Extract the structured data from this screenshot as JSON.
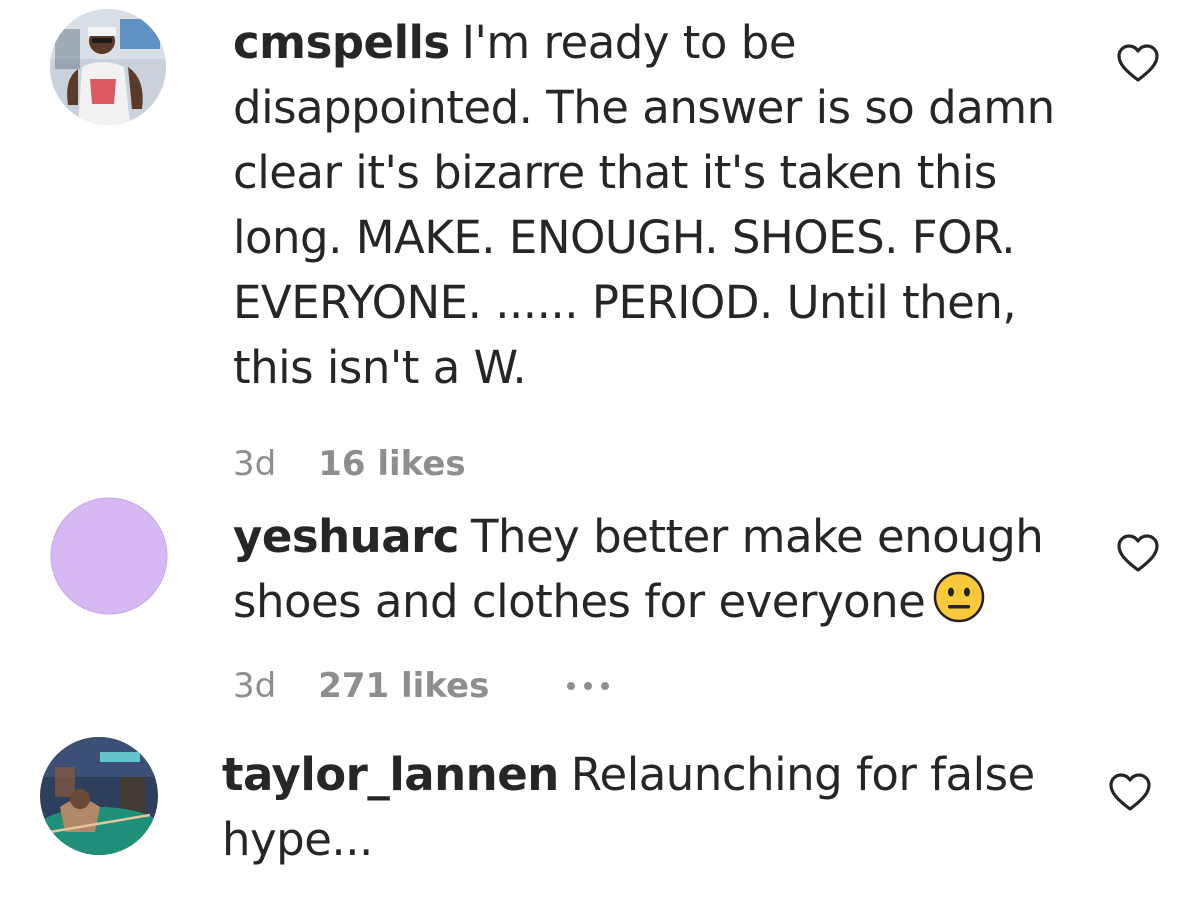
{
  "comments": [
    {
      "username": "cmspells",
      "text": "I'm ready to be disappointed. The answer is so damn clear it's bizarre that it's taken this long. MAKE. ENOUGH. SHOES. FOR. EVERYONE. ...... PERIOD. Until then, this isn't a W.",
      "time": "3d",
      "likes": "16 likes",
      "avatar_icon": "profile-photo"
    },
    {
      "username": "yeshuarc",
      "text": "They better make enough shoes and clothes for everyone",
      "emoji": "neutral-face-emoji",
      "time": "3d",
      "likes": "271 likes",
      "avatar_color": "#d7b8f3"
    },
    {
      "username": "taylor_lannen",
      "text": "Relaunching for false hype...",
      "avatar_icon": "profile-photo"
    }
  ],
  "colors": {
    "text": "#262626",
    "meta": "#8e8e8e",
    "heart_stroke": "#262626"
  },
  "icons": {
    "like": "heart-outline-icon",
    "more": "more-options-icon"
  }
}
